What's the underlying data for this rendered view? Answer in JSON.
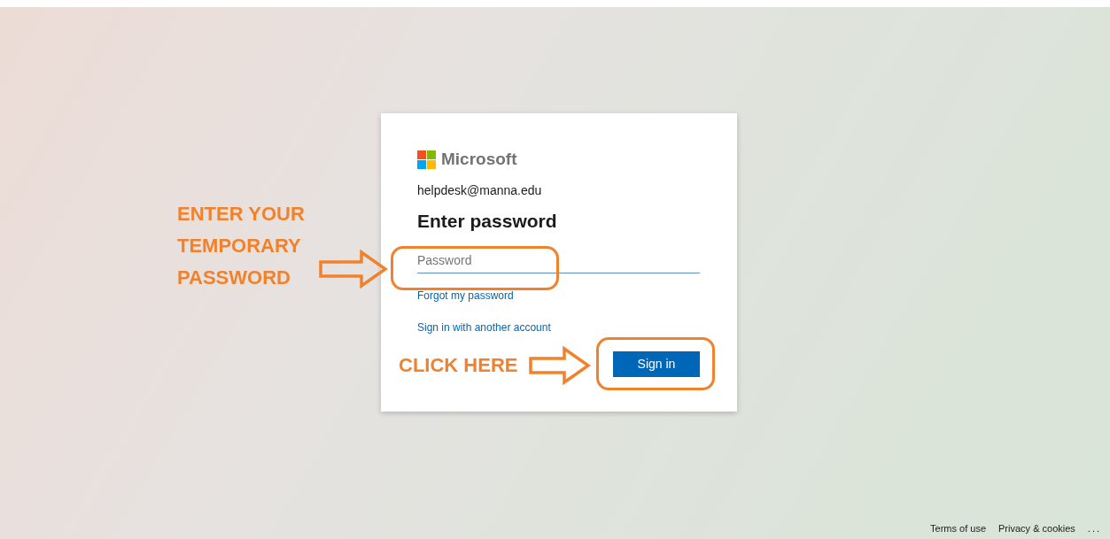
{
  "signin": {
    "brand": "Microsoft",
    "account": "helpdesk@manna.edu",
    "heading": "Enter password",
    "password": {
      "placeholder": "Password"
    },
    "links": [
      "Forgot my password",
      "Sign in with another account"
    ],
    "button": "Sign in"
  },
  "annotations": {
    "password_hint": "ENTER YOUR TEMPORARY PASSWORD",
    "button_hint": "CLICK HERE"
  },
  "footer": {
    "links": [
      "Terms of use",
      "Privacy & cookies"
    ],
    "more": "..."
  }
}
